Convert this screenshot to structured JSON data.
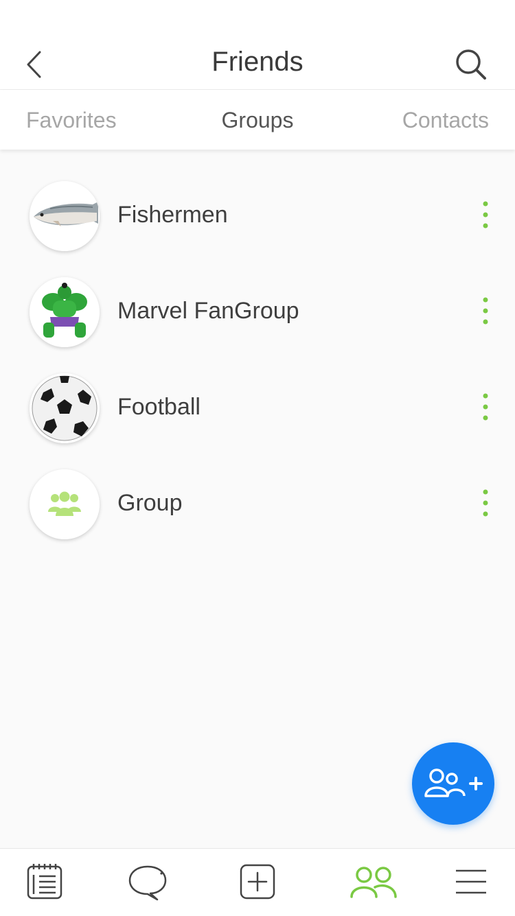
{
  "header": {
    "title": "Friends"
  },
  "tabs": [
    {
      "label": "Favorites",
      "active": false
    },
    {
      "label": "Groups",
      "active": true
    },
    {
      "label": "Contacts",
      "active": false
    }
  ],
  "groups": [
    {
      "name": "Fishermen",
      "avatar": "fish-photo"
    },
    {
      "name": "Marvel FanGroup",
      "avatar": "hulk-figure-photo"
    },
    {
      "name": "Football",
      "avatar": "soccer-ball-photo"
    },
    {
      "name": "Group",
      "avatar": "group-icon"
    }
  ],
  "colors": {
    "accent_green": "#7ac943",
    "fab_blue": "#1780f2",
    "group_icon_green": "#b5e27a"
  },
  "fab": {
    "icon": "add-people-icon"
  },
  "bottom_nav": [
    {
      "icon": "notes-icon",
      "active": false
    },
    {
      "icon": "chat-bubble-icon",
      "active": false
    },
    {
      "icon": "add-square-icon",
      "active": false
    },
    {
      "icon": "friends-icon",
      "active": true
    },
    {
      "icon": "menu-icon",
      "active": false
    }
  ]
}
